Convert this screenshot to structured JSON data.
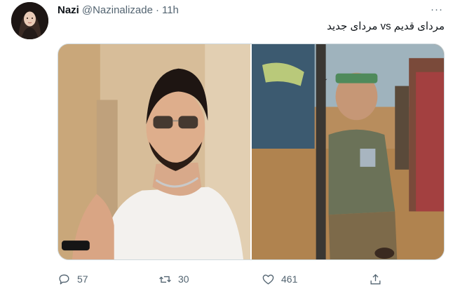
{
  "tweet": {
    "author": {
      "display_name": "Nazi",
      "handle": "@Nazinalizade",
      "separator": "·",
      "time": "11h"
    },
    "more_label": "···",
    "text": "مردای قدیم vs مردای جدید",
    "media": {
      "left_image_icon": "photo-man-sunglasses",
      "right_image_icon": "photo-boy-with-rifle"
    },
    "actions": {
      "reply": {
        "icon": "reply-icon",
        "count": "57"
      },
      "retweet": {
        "icon": "retweet-icon",
        "count": "30"
      },
      "like": {
        "icon": "heart-icon",
        "count": "461"
      },
      "share": {
        "icon": "share-icon"
      }
    }
  },
  "colors": {
    "text_primary": "#0f1419",
    "text_secondary": "#536471",
    "border": "#cfd9de"
  }
}
